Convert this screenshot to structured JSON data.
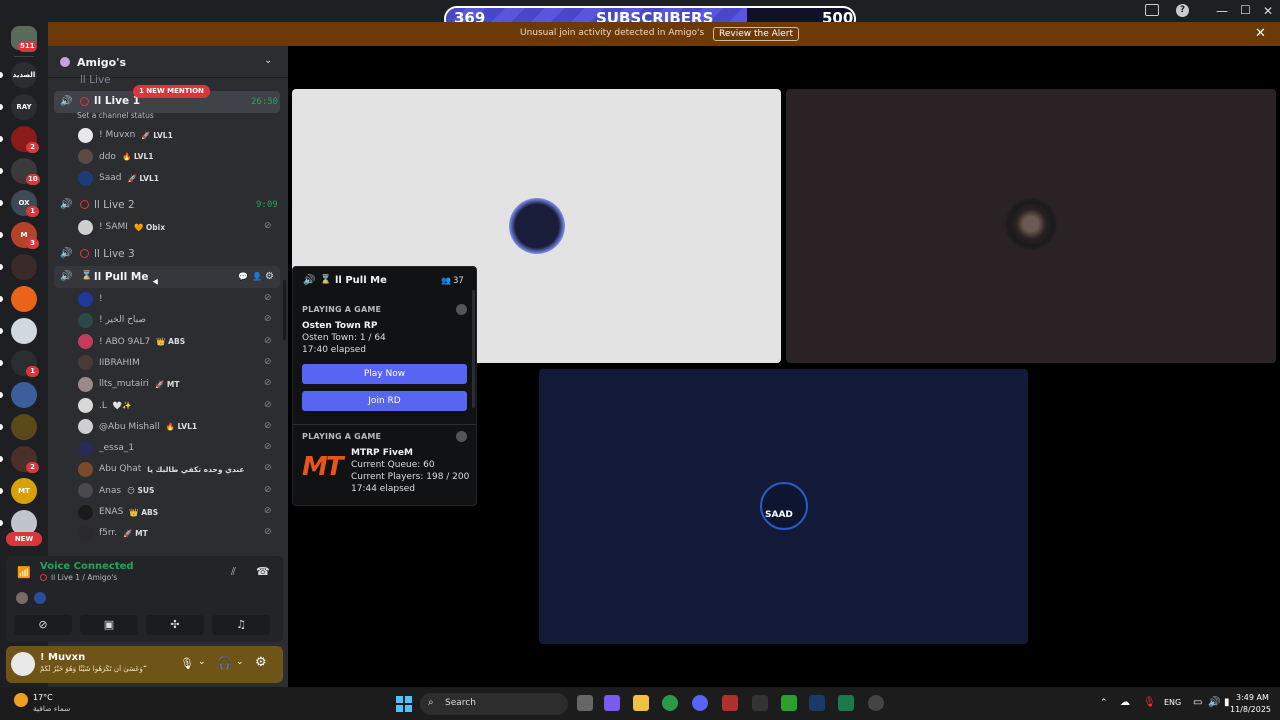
{
  "subscriber_goal": {
    "current": "369",
    "label": "SUBSCRIBERS",
    "target": "500",
    "progress_fraction": 0.738
  },
  "alert": {
    "text": "Unusual join activity detected in Amigo's",
    "action": "Review the Alert"
  },
  "rail": {
    "home_badge": "511",
    "servers": [
      {
        "label": "الصديد",
        "color": "#2b2d31"
      },
      {
        "label": "RAY",
        "color": "#2b2d31",
        "badge": ""
      },
      {
        "label": "",
        "color": "#8b1a1a",
        "badge": "2"
      },
      {
        "label": "",
        "color": "#3a3a3a",
        "badge": "10"
      },
      {
        "label": "OX",
        "color": "#3d4a56",
        "badge": "1"
      },
      {
        "label": "M",
        "color": "#b5432a",
        "badge": "3"
      },
      {
        "label": "",
        "color": "#3a2a2a"
      },
      {
        "label": "",
        "color": "#e8641b"
      },
      {
        "label": "",
        "color": "#d0d8e0"
      },
      {
        "label": "",
        "color": "#2a2e33",
        "badge": "1"
      },
      {
        "label": "",
        "color": "#3a5f9a"
      },
      {
        "label": "",
        "color": "#5a4a1a"
      },
      {
        "label": "",
        "color": "#4a3028",
        "badge": "2"
      },
      {
        "label": "MT",
        "color": "#d8a10a"
      },
      {
        "label": "",
        "color": "#c0c4cc"
      }
    ],
    "new_label": "NEW"
  },
  "server": {
    "name": "Amigo's"
  },
  "channels": {
    "top_partial": "اا Live",
    "live1": {
      "name": "اا Live 1",
      "mention": "1 NEW MENTION",
      "time": "26:50",
      "status": "Set a channel status",
      "users": [
        {
          "name": "! Muvxn",
          "tag": "🚀 LVL1",
          "color": "#e8e8e8"
        },
        {
          "name": "ddo",
          "tag": "🔥 LVL1",
          "color": "#5b4a44"
        },
        {
          "name": "Saad",
          "tag": "🚀 LVL1",
          "color": "#1d3a7a"
        }
      ]
    },
    "live2": {
      "name": "اا Live 2",
      "time": "9:09",
      "users": [
        {
          "name": "! SAMI",
          "tag": "🧡 Obix",
          "color": "#cfcfcf"
        }
      ]
    },
    "live3": {
      "name": "اا Live 3"
    },
    "pullme": {
      "name": "اا Pull Me",
      "users": [
        {
          "name": "!",
          "tag": "",
          "color": "#1d3a9a"
        },
        {
          "name": "! صباح الخير",
          "tag": "",
          "color": "#2a4a4a"
        },
        {
          "name": "! ABO 9AL7",
          "tag": "👑 ABS",
          "color": "#c43c5c"
        },
        {
          "name": "IIBRAHIM",
          "tag": "",
          "color": "#4a3a3a"
        },
        {
          "name": "llts_mutairi",
          "tag": "🚀 MT",
          "color": "#9a8a8a"
        },
        {
          "name": ".L",
          "tag": "🤍✨",
          "color": "#d8d8d8"
        },
        {
          "name": "@Abu Mishall",
          "tag": "🔥 LVL1",
          "color": "#cfcfcf"
        },
        {
          "name": "_essa_1",
          "tag": "",
          "color": "#2a2a5a"
        },
        {
          "name": "Abu Qhat",
          "tag": "عندي وحده تكفي طالبك يا",
          "color": "#7a4a2a"
        },
        {
          "name": "Anas",
          "tag": "😶 SUS",
          "color": "#4a4a4a"
        },
        {
          "name": "ENAS",
          "tag": "👑 ABS",
          "color": "#1a1a1a"
        },
        {
          "name": "f5rr.",
          "tag": "🚀 MT",
          "color": "#2a2a2a"
        }
      ]
    }
  },
  "popup": {
    "channel": "اا Pull Me",
    "count": "37",
    "game1": {
      "header": "PLAYING A GAME",
      "title": "Osten Town RP",
      "detail": "Osten Town: 1 / 64",
      "elapsed": "17:40 elapsed",
      "btn1": "Play Now",
      "btn2": "Join RD"
    },
    "game2": {
      "header": "PLAYING A GAME",
      "title": "MTRP FiveM",
      "queue": "Current Queue: 60",
      "players": "Current Players: 198 / 200",
      "elapsed": "17:44 elapsed",
      "logo": "MT"
    }
  },
  "voice": {
    "status": "Voice Connected",
    "channel": "اا Live 1 / Amigo's"
  },
  "user": {
    "name": "! Muvxn",
    "status": "وَعَسَىٰ أَن تَكْرَهُوا شَيْئًا وَهُوَ خَيْرٌ لَّكُمْ ۖ"
  },
  "tiles": {
    "saad_logo": "SAAD"
  },
  "taskbar": {
    "weather_temp": "17°C",
    "weather_text": "سماء صافية",
    "search": "Search",
    "lang": "ENG",
    "time": "3:49 AM",
    "date": "11/8/2025"
  }
}
